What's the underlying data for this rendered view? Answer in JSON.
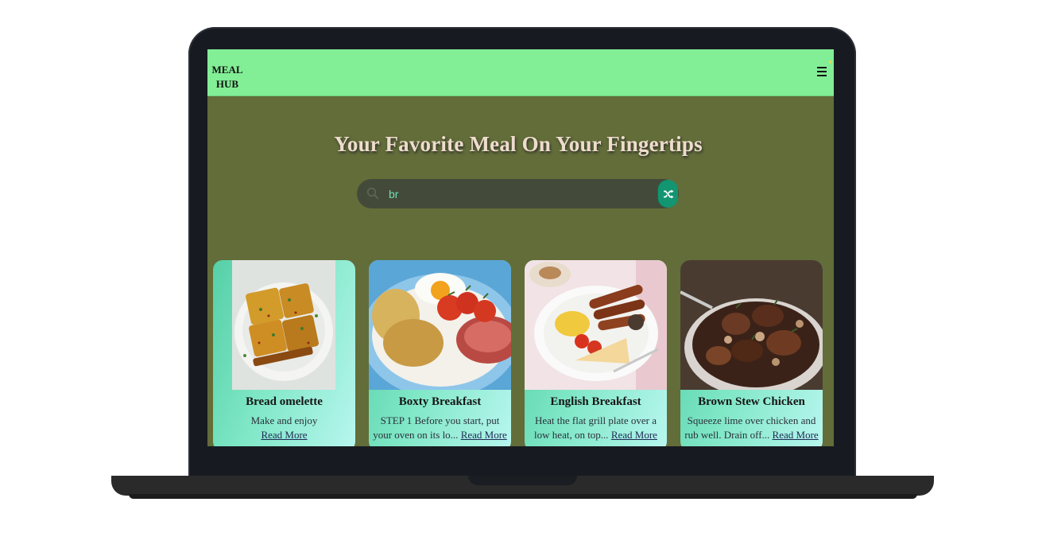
{
  "brand": {
    "line1": "MEAL",
    "line2": "HUB"
  },
  "hero": {
    "title": "Your Favorite Meal On Your Fingertips"
  },
  "search": {
    "value": "br",
    "placeholder": ""
  },
  "icons": {
    "search": "search-icon",
    "shuffle": "shuffle-icon",
    "menu": "menu-icon"
  },
  "colors": {
    "navbar": "#82ee96",
    "background": "#626d39",
    "accent": "#139571",
    "search_text": "#6fe0b6"
  },
  "meals": [
    {
      "title": "Bread omelette",
      "desc": "Make and enjoy",
      "link": "Read More"
    },
    {
      "title": "Boxty Breakfast",
      "desc": "STEP 1 Before you start, put your oven on its lo...",
      "link": "Read More"
    },
    {
      "title": "English Breakfast",
      "desc": "Heat the flat grill plate over a low heat, on top...",
      "link": "Read More"
    },
    {
      "title": "Brown Stew Chicken",
      "desc": "Squeeze lime over chicken and rub well. Drain off...",
      "link": "Read More"
    }
  ]
}
